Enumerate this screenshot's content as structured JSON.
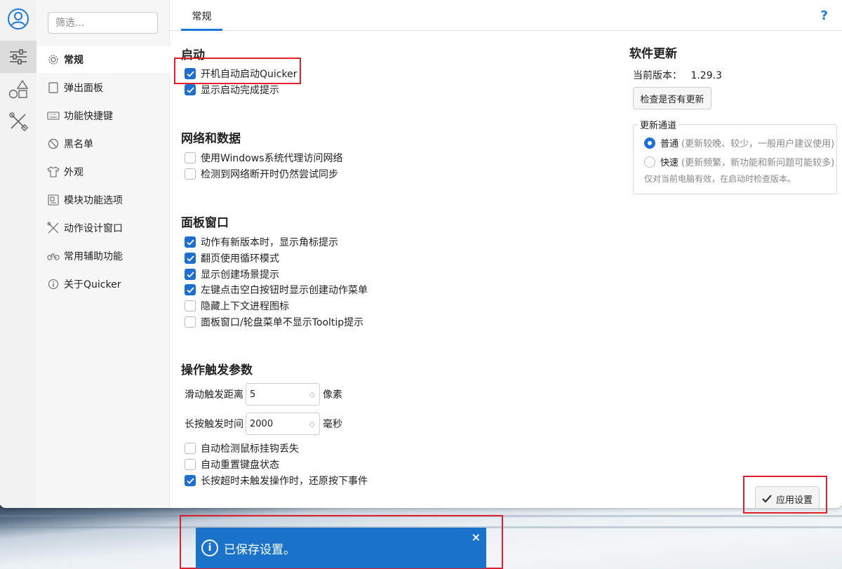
{
  "nav": {
    "filter_placeholder": "筛选...",
    "items": [
      {
        "label": "常规",
        "icon": "gear-icon",
        "active": true
      },
      {
        "label": "弹出面板",
        "icon": "panel-icon"
      },
      {
        "label": "功能快捷键",
        "icon": "keyboard-icon"
      },
      {
        "label": "黑名单",
        "icon": "block-icon"
      },
      {
        "label": "外观",
        "icon": "shirt-icon"
      },
      {
        "label": "模块功能选项",
        "icon": "module-icon"
      },
      {
        "label": "动作设计窗口",
        "icon": "tools-icon"
      },
      {
        "label": "常用辅助功能",
        "icon": "bicycle-icon"
      },
      {
        "label": "关于Quicker",
        "icon": "info-icon"
      }
    ]
  },
  "tab": {
    "label": "常规"
  },
  "help": "?",
  "sections": {
    "startup": {
      "title": "启动",
      "items": [
        {
          "label": "开机自动启动Quicker",
          "checked": true
        },
        {
          "label": "显示启动完成提示",
          "checked": true
        }
      ]
    },
    "network": {
      "title": "网络和数据",
      "items": [
        {
          "label": "使用Windows系统代理访问网络",
          "checked": false
        },
        {
          "label": "检测到网络断开时仍然尝试同步",
          "checked": false
        }
      ]
    },
    "panel": {
      "title": "面板窗口",
      "items": [
        {
          "label": "动作有新版本时，显示角标提示",
          "checked": true
        },
        {
          "label": "翻页使用循环模式",
          "checked": true
        },
        {
          "label": "显示创建场景提示",
          "checked": true
        },
        {
          "label": "左键点击空白按钮时显示创建动作菜单",
          "checked": true
        },
        {
          "label": "隐藏上下文进程图标",
          "checked": false
        },
        {
          "label": "面板窗口/轮盘菜单不显示Tooltip提示",
          "checked": false
        }
      ]
    },
    "trigger": {
      "title": "操作触发参数",
      "swipe": {
        "label": "滑动触发距离",
        "value": "5",
        "unit": "像素"
      },
      "longpress": {
        "label": "长按触发时间",
        "value": "2000",
        "unit": "毫秒"
      },
      "items": [
        {
          "label": "自动检测鼠标挂钩丢失",
          "checked": false
        },
        {
          "label": "自动重置键盘状态",
          "checked": false
        },
        {
          "label": "长按超时未触发操作时，还原按下事件",
          "checked": true
        }
      ]
    }
  },
  "update": {
    "title": "软件更新",
    "version_label": "当前版本：",
    "version": "1.29.3",
    "check_button": "检查是否有更新",
    "channel_legend": "更新通道",
    "normal": {
      "label": "普通",
      "desc": "(更新较晚、较少，一般用户建议使用)",
      "selected": true
    },
    "fast": {
      "label": "快速",
      "desc": "(更新频繁，新功能和新问题可能较多)",
      "selected": false
    },
    "note": "仅对当前电脑有效，在启动时检查版本。"
  },
  "apply_button": "应用设置",
  "toast": {
    "message": "已保存设置。",
    "close": "×"
  },
  "colors": {
    "accent": "#1e6fd0",
    "toast": "#1a73c9",
    "highlight": "#e0202a"
  }
}
